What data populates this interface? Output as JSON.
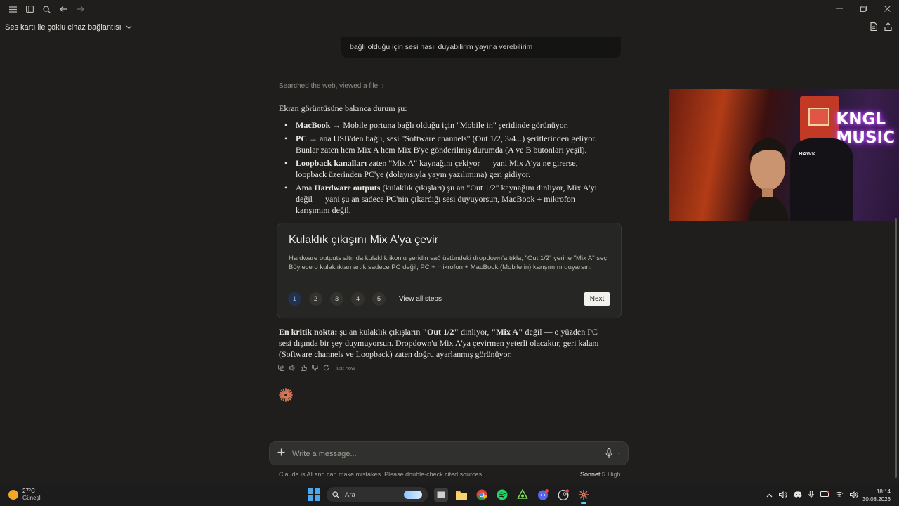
{
  "conversation": {
    "title": "Ses kartı ile çoklu cihaz bağlantısı"
  },
  "prev_user_message": {
    "text": "bağlı olduğu için sesi nasıl duyabilirim yayına verebilirim"
  },
  "tool_summary": {
    "label": "Searched the web, viewed a file"
  },
  "answer": {
    "intro": "Ekran görüntüsüne bakınca durum şu:",
    "bullets": [
      {
        "bold": "MacBook",
        "text": " → Mobile portuna bağlı olduğu için \"Mobile in\" şeridinde görünüyor."
      },
      {
        "bold": "PC",
        "text": " → ana USB'den bağlı, sesi \"Software channels\" (Out 1/2, 3/4...) şeritlerinden geliyor. Bunlar zaten hem Mix A hem Mix B'ye gönderilmiş durumda (A ve B butonları yeşil)."
      },
      {
        "bold": "Loopback kanalları",
        "text": " zaten \"Mix A\" kaynağını çekiyor — yani Mix A'ya ne girerse, loopback üzerinden PC'ye (dolayısıyla yayın yazılımına) geri gidiyor."
      },
      {
        "pre": "Ama ",
        "bold": "Hardware outputs",
        "text": " (kulaklık çıkışları) şu an \"Out 1/2\" kaynağını dinliyor, Mix A'yı değil — yani şu an sadece PC'nin çıkardığı sesi duyuyorsun, MacBook + mikrofon karışımını değil."
      }
    ]
  },
  "steps_card": {
    "title": "Kulaklık çıkışını Mix A'ya çevir",
    "description": "Hardware outputs altında kulaklık ikonlu şeridin sağ üstündeki dropdown'a tıkla, \"Out 1/2\" yerine \"Mix A\" seç. Böylece o kulaklıktan artık sadece PC değil, PC + mikrofon + MacBook (Mobile in) karışımını duyarsın.",
    "steps": [
      "1",
      "2",
      "3",
      "4",
      "5"
    ],
    "active_step": "1",
    "view_all_label": "View all steps",
    "next_label": "Next"
  },
  "conclusion": {
    "p1": "En kritik nokta: şu an kulaklık çıkışların ",
    "b1": "\"Out 1/2\"",
    "p2": " dinliyor, ",
    "b2": "\"Mix A\"",
    "p3": " değil — o yüzden PC sesi dışında bir şey duymuyorsun. Dropdown'u Mix A'ya çevirmen yeterli olacaktır, geri kalanı (Software channels ve Loopback) zaten doğru ayarlanmış görünüyor."
  },
  "message_actions": {
    "timestamp": "just now"
  },
  "webcam": {
    "neon_line1": "KNGL",
    "neon_line2": "MUSIC",
    "chair_brand": "HAWK"
  },
  "composer": {
    "placeholder": "Write a message...",
    "disclaimer": "Claude is AI and can make mistakes. Please double-check cited sources.",
    "model": "Sonnet 5",
    "effort": "High"
  },
  "taskbar": {
    "temperature": "27°C",
    "condition": "Güneşli",
    "search_placeholder": "Ara",
    "time": "18:14",
    "date": "30.08.2026"
  },
  "colors": {
    "background": "#1f1e1d",
    "card": "#262624",
    "accent_orange": "#d97757",
    "active_step": "#8fb2ec"
  }
}
